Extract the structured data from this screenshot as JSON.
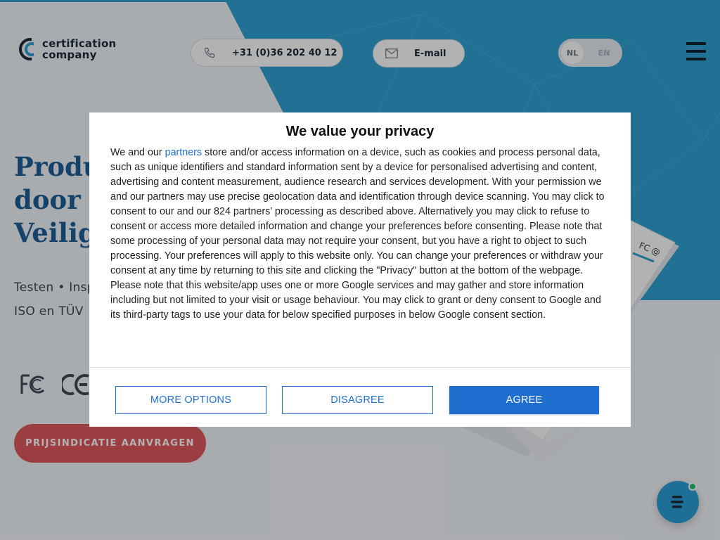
{
  "header": {
    "logo_line1": "certification",
    "logo_line2": "company",
    "phone": "+31 (0)36 202 40 12",
    "email_label": "E-mail",
    "languages": [
      "NL",
      "EN"
    ],
    "active_language": "NL"
  },
  "hero": {
    "title_lines": [
      "Produ",
      "door E",
      "Veilig"
    ],
    "subtitle_lines": [
      "Testen • Insp",
      "ISO en TÜV"
    ],
    "cta_label": "PRIJSINDICATIE AANVRAGEN"
  },
  "consent": {
    "title": "We value your privacy",
    "intro": "We and our ",
    "link_text": "partners",
    "body": " store and/or access information on a device, such as cookies and process personal data, such as unique identifiers and standard information sent by a device for personalised advertising and content, advertising and content measurement, audience research and services development. With your permission we and our partners may use precise geolocation data and identification through device scanning. You may click to consent to our and our 824 partners’ processing as described above. Alternatively you may click to refuse to consent or access more detailed information and change your preferences before consenting. Please note that some processing of your personal data may not require your consent, but you have a right to object to such processing. Your preferences will apply to this website only. You can change your preferences or withdraw your consent at any time by returning to this site and clicking the \"Privacy\" button at the bottom of the webpage. Please note that this website/app uses one or more Google services and may gather and store information including but not limited to your visit or usage behaviour. You may click to grant or deny consent to Google and its third-party tags to use your data for below specified purposes in below Google consent section.",
    "buttons": {
      "more_options": "MORE OPTIONS",
      "disagree": "DISAGREE",
      "agree": "AGREE"
    }
  },
  "colors": {
    "brand_blue": "#2ea3d4",
    "cta_red": "#e05a5d",
    "consent_blue": "#1f6fd0"
  },
  "icons": [
    "phone-icon",
    "mail-icon",
    "hamburger-menu-icon",
    "chat-icon",
    "fc-logo",
    "ce-logo"
  ]
}
